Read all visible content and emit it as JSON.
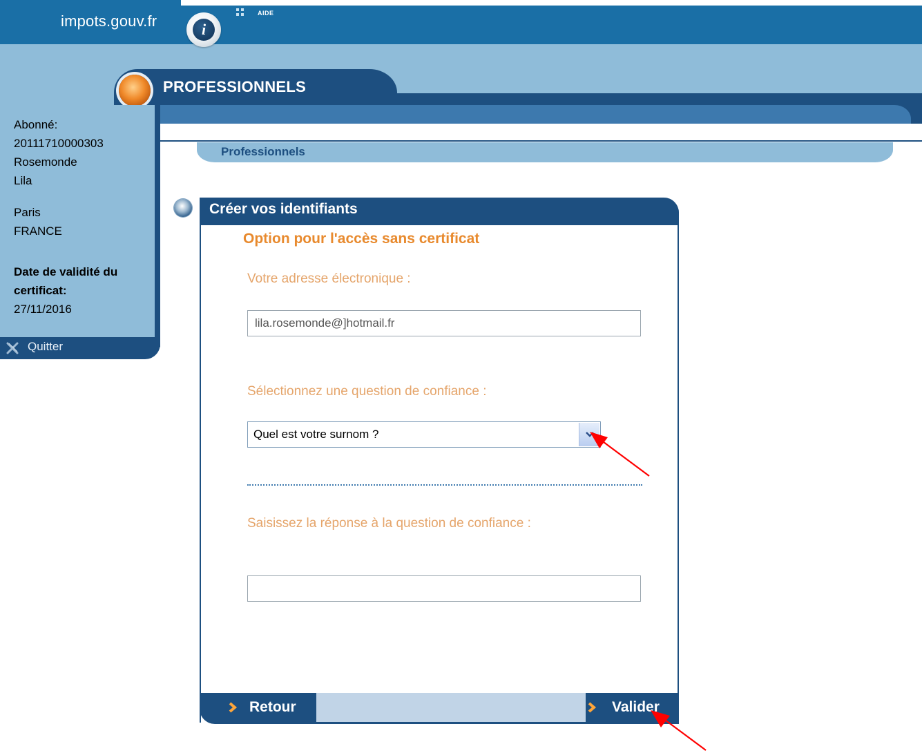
{
  "header": {
    "site_name": "impots.gouv.fr",
    "info_icon_glyph": "i",
    "help_label": "AIDE"
  },
  "section": {
    "title": "PROFESSIONNELS",
    "breadcrumb": "Professionnels"
  },
  "sidebar": {
    "subscriber_label": "Abonné:",
    "subscriber_id": "20111710000303",
    "last_name": "Rosemonde",
    "first_name": "Lila",
    "city": "Paris",
    "country": "FRANCE",
    "validity_label_line1": "Date de validité du",
    "validity_label_line2": "certificat:",
    "validity_date": "27/11/2016",
    "quit_label": "Quitter"
  },
  "form": {
    "title": "Créer vos identifiants",
    "subtitle": "Option pour l'accès sans certificat",
    "email_label": "Votre adresse électronique :",
    "email_value": "lila.rosemonde@]hotmail.fr",
    "question_label": "Sélectionnez une question de confiance :",
    "question_selected": "Quel est votre surnom ?",
    "answer_label": "Saisissez la réponse à la question de confiance :",
    "answer_value": ""
  },
  "nav": {
    "back_label": "Retour",
    "submit_label": "Valider"
  },
  "colors": {
    "primary_dark": "#1d4f80",
    "primary_top": "#1a6fa6",
    "band_light": "#8fbcd9",
    "accent_orange": "#e88a2e",
    "label_orange": "#e5a56b",
    "annotation_red": "#ff0000"
  }
}
